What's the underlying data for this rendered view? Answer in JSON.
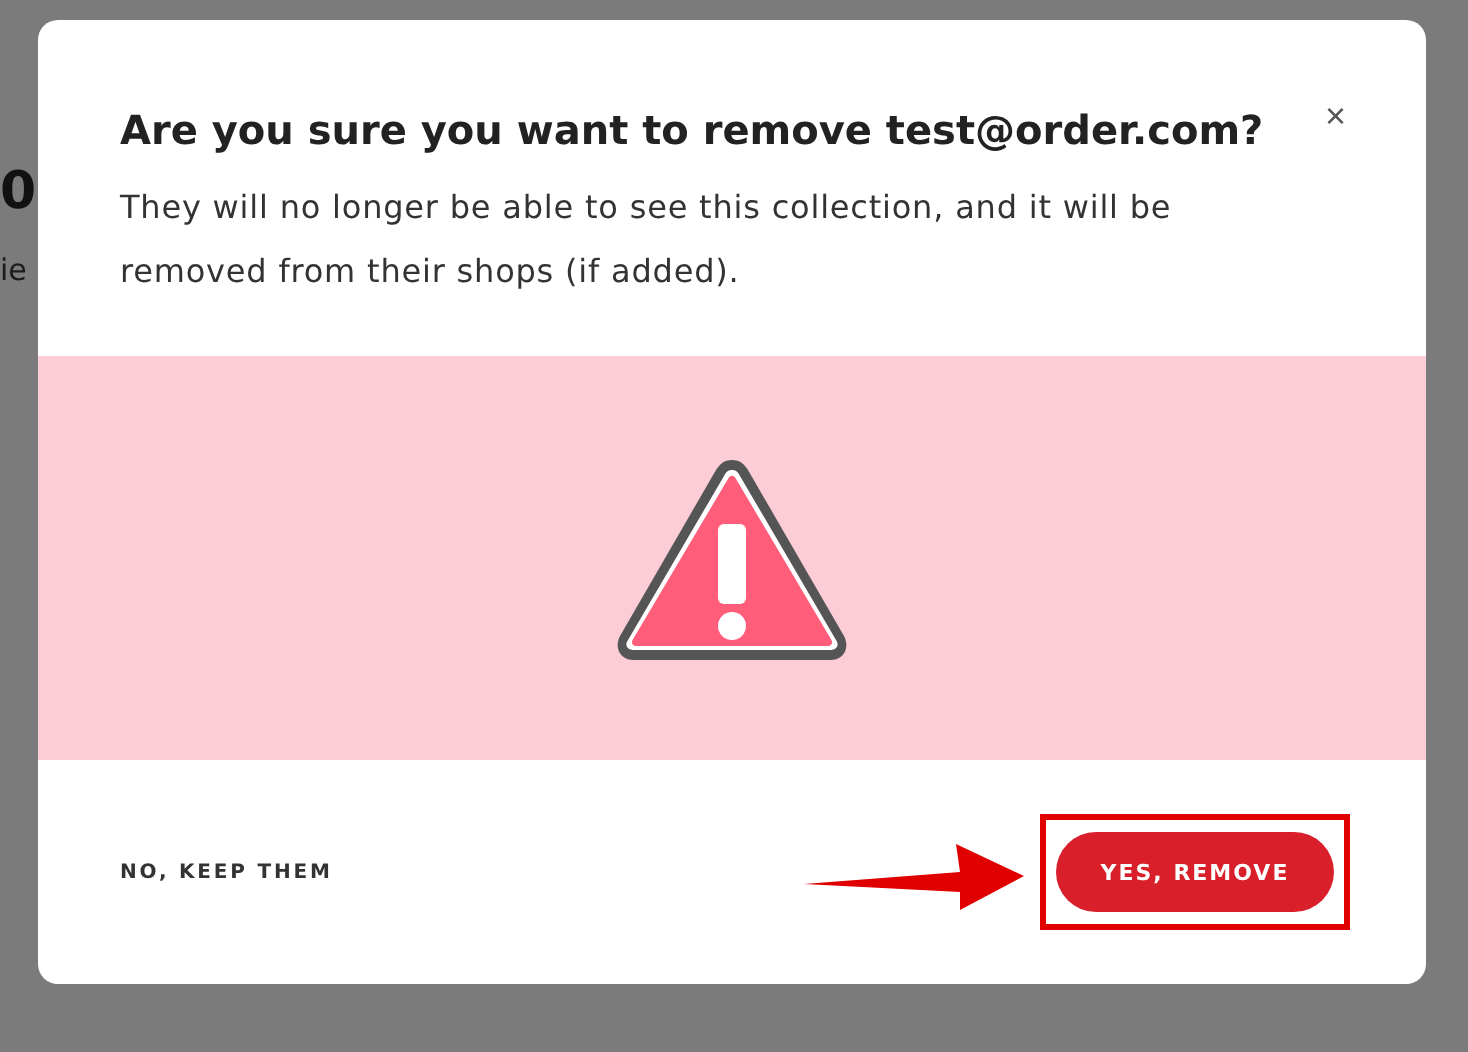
{
  "background_page": {
    "heading": "0",
    "text": "ie"
  },
  "dialog": {
    "title": "Are you sure you want to remove test@order.com?",
    "close": "×",
    "message": "They will no longer be able to see this collection, and it will be removed from their shops (if added).",
    "cancel_button": "NO, KEEP THEM",
    "confirm_button": "YES, REMOVE"
  }
}
